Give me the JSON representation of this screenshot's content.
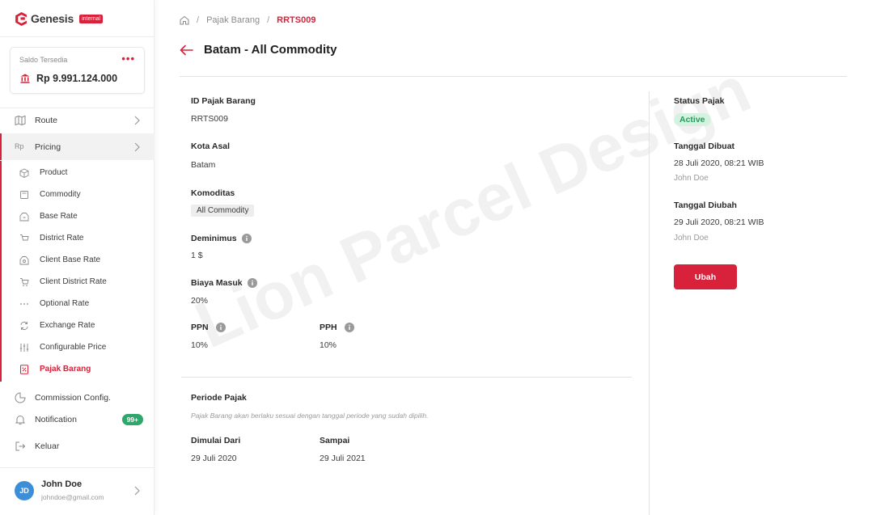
{
  "brand": {
    "name": "Genesis",
    "badge": "internal"
  },
  "balance": {
    "label": "Saldo Tersedia",
    "value": "Rp 9.991.124.000",
    "more": "•••"
  },
  "nav": {
    "route": "Route",
    "pricing": "Pricing",
    "pricing_sub": [
      {
        "label": "Product",
        "icon": "box-icon"
      },
      {
        "label": "Commodity",
        "icon": "commodity-icon"
      },
      {
        "label": "Base Rate",
        "icon": "base-rate-icon"
      },
      {
        "label": "District Rate",
        "icon": "district-rate-icon"
      },
      {
        "label": "Client Base Rate",
        "icon": "client-base-rate-icon"
      },
      {
        "label": "Client District Rate",
        "icon": "client-district-rate-icon"
      },
      {
        "label": "Optional Rate",
        "icon": "dots-icon"
      },
      {
        "label": "Exchange Rate",
        "icon": "exchange-icon"
      },
      {
        "label": "Configurable Price",
        "icon": "sliders-icon"
      },
      {
        "label": "Pajak Barang",
        "icon": "tax-icon"
      }
    ],
    "commission": "Commission Config.",
    "notification": "Notification",
    "notification_badge": "99+",
    "logout": "Keluar"
  },
  "user": {
    "initials": "JD",
    "name": "John Doe",
    "email": "johndoe@gmail.com"
  },
  "breadcrumb": {
    "sep": "/",
    "section": "Pajak Barang",
    "current": "RRTS009"
  },
  "page": {
    "title": "Batam - All Commodity"
  },
  "detail": {
    "id_label": "ID Pajak Barang",
    "id_value": "RRTS009",
    "kota_label": "Kota Asal",
    "kota_value": "Batam",
    "komoditas_label": "Komoditas",
    "komoditas_value": "All Commodity",
    "deminimus_label": "Deminimus",
    "deminimus_value": "1 $",
    "biaya_label": "Biaya Masuk",
    "biaya_value": "20%",
    "ppn_label": "PPN",
    "ppn_value": "10%",
    "pph_label": "PPH",
    "pph_value": "10%",
    "periode_label": "Periode Pajak",
    "periode_help": "Pajak Barang akan berlaku sesuai dengan tanggal periode yang sudah dipilih.",
    "mulai_label": "Dimulai Dari",
    "mulai_value": "29 Juli 2020",
    "sampai_label": "Sampai",
    "sampai_value": "29 Juli 2021"
  },
  "side": {
    "status_label": "Status Pajak",
    "status_value": "Active",
    "dibuat_label": "Tanggal Dibuat",
    "dibuat_value": "28 Juli 2020, 08:21 WIB",
    "dibuat_by": "John Doe",
    "diubah_label": "Tanggal Diubah",
    "diubah_value": "29 Juli 2020, 08:21 WIB",
    "diubah_by": "John Doe",
    "edit_button": "Ubah"
  },
  "watermark": "Lion Parcel Design",
  "colors": {
    "accent": "#d8213b",
    "success": "#2a9a5c",
    "avatar": "#3d8ed8"
  }
}
